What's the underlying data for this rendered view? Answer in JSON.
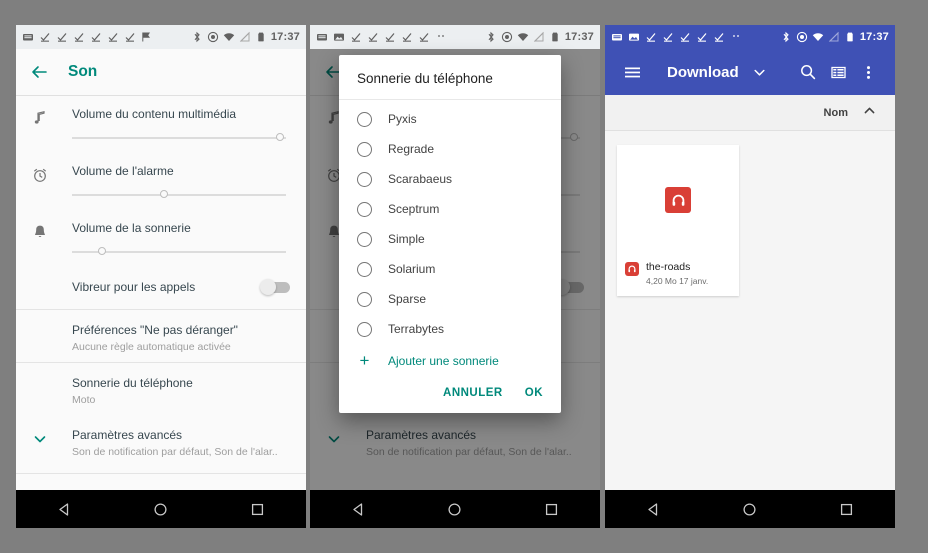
{
  "statusbar": {
    "time": "17:37",
    "icons_left": [
      "keyboard-icon",
      "checkmark-icon",
      "checkmark-icon",
      "checkmark-icon",
      "checkmark-icon",
      "checkmark-icon",
      "checkmark-icon",
      "flag-icon"
    ],
    "icons_right": [
      "bluetooth-icon",
      "location-icon",
      "wifi-icon",
      "signal-off-icon",
      "battery-icon"
    ]
  },
  "panel1": {
    "appbar": {
      "back_icon": "back-arrow-icon",
      "title": "Son"
    },
    "rows": [
      {
        "icon": "music-note-icon",
        "title": "Volume du contenu multimédia",
        "slider": 97
      },
      {
        "icon": "alarm-clock-icon",
        "title": "Volume de l'alarme",
        "slider": 43
      },
      {
        "icon": "bell-icon",
        "title": "Volume de la sonnerie",
        "slider": 14
      }
    ],
    "vibrate": {
      "label": "Vibreur pour les appels",
      "state": "off"
    },
    "dnd": {
      "title": "Préférences \"Ne pas déranger\"",
      "subtitle": "Aucune règle automatique activée"
    },
    "ringtone": {
      "title": "Sonnerie du téléphone",
      "subtitle": "Moto"
    },
    "advanced": {
      "title": "Paramètres avancés",
      "subtitle": "Son de notification par défaut, Son de l'alar..",
      "icon": "chevron-down-icon"
    }
  },
  "panel2": {
    "dialog": {
      "title": "Sonnerie du téléphone",
      "options": [
        {
          "label": "Pyxis",
          "selected": false
        },
        {
          "label": "Regrade",
          "selected": false
        },
        {
          "label": "Scarabaeus",
          "selected": false
        },
        {
          "label": "Sceptrum",
          "selected": false
        },
        {
          "label": "Simple",
          "selected": false
        },
        {
          "label": "Solarium",
          "selected": false
        },
        {
          "label": "Sparse",
          "selected": false
        },
        {
          "label": "Terrabytes",
          "selected": false
        }
      ],
      "add_label": "Ajouter une sonnerie",
      "add_icon": "plus-icon",
      "cancel_label": "ANNULER",
      "ok_label": "OK"
    }
  },
  "panel3": {
    "appbar": {
      "menu_icon": "hamburger-menu-icon",
      "title": "Download",
      "dropdown_icon": "chevron-down-icon",
      "search_icon": "search-icon",
      "view_icon": "grid-view-icon",
      "overflow_icon": "more-vert-icon"
    },
    "sortbar": {
      "label": "Nom",
      "icon": "chevron-up-icon"
    },
    "files": [
      {
        "name": "the-roads",
        "details": "4,20 Mo  17 janv.",
        "icon": "audio-file-icon",
        "icon_color": "#d93f36"
      }
    ]
  },
  "navbar": {
    "back_icon": "nav-back-triangle-icon",
    "home_icon": "nav-home-circle-icon",
    "recents_icon": "nav-recents-square-icon"
  },
  "colors": {
    "accent_teal": "#00897b",
    "appbar_blue": "#3f51b5",
    "audio_red": "#d93f36"
  }
}
